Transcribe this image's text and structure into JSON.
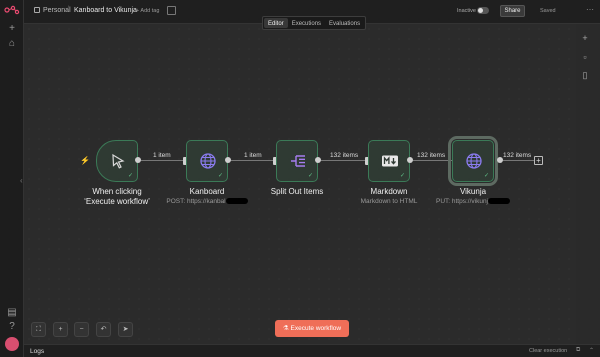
{
  "header": {
    "project": "Personal",
    "separator": "/",
    "workflow_name": "Kanboard to Vikunja",
    "add_tag": "+ Add tag",
    "status": "Inactive",
    "share_label": "Share",
    "saved_label": "Saved",
    "more": "⋯"
  },
  "tabs": [
    {
      "label": "Editor",
      "active": true
    },
    {
      "label": "Executions",
      "active": false
    },
    {
      "label": "Evaluations",
      "active": false
    }
  ],
  "nodes": [
    {
      "name": "trigger",
      "title": "When clicking\n‘Execute workflow’",
      "subtitle": "",
      "icon": "cursor-icon"
    },
    {
      "name": "kanboard",
      "title": "Kanboard",
      "subtitle": "POST: https://kanbal",
      "icon": "globe-icon"
    },
    {
      "name": "split-out",
      "title": "Split Out Items",
      "subtitle": "",
      "icon": "split-out-icon"
    },
    {
      "name": "markdown",
      "title": "Markdown",
      "subtitle": "Markdown to HTML",
      "icon": "markdown-icon"
    },
    {
      "name": "vikunja",
      "title": "Vikunja",
      "subtitle": "PUT: https://vikunj",
      "icon": "globe-icon"
    }
  ],
  "connections": [
    "1 item",
    "1 item",
    "132 items",
    "132 items",
    "132 items"
  ],
  "execute_label": "Execute workflow",
  "logs": {
    "label": "Logs",
    "clear_label": "Clear execution"
  },
  "colors": {
    "accent": "#ef6e58",
    "node_border": "#3b7a57",
    "trigger_bolt": "#e0533d"
  }
}
